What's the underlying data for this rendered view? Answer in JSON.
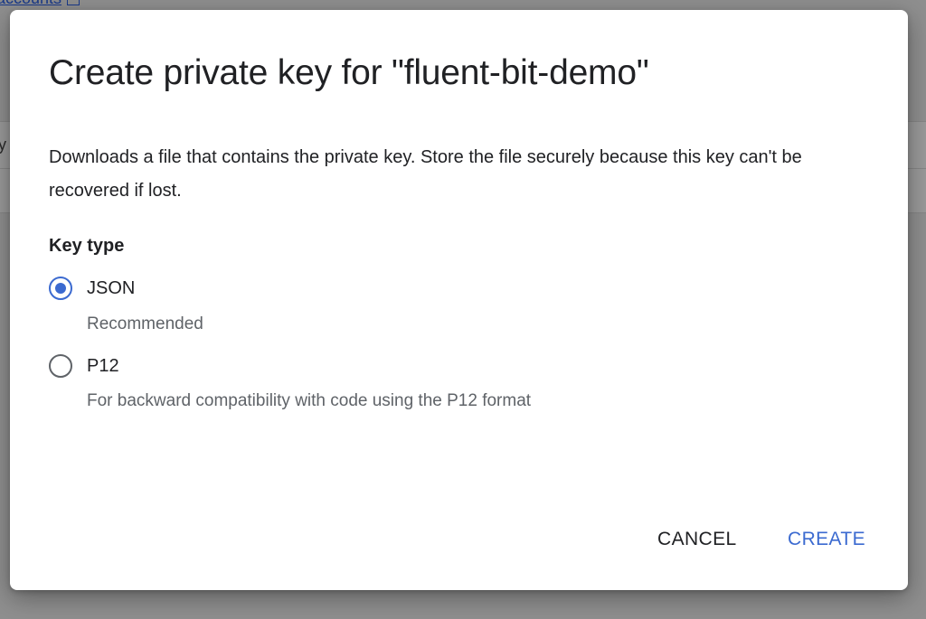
{
  "background": {
    "link_text": "accounts",
    "edge_glyph": "y"
  },
  "dialog": {
    "title": "Create private key for \"fluent-bit-demo\"",
    "description": "Downloads a file that contains the private key. Store the file securely because this key can't be recovered if lost.",
    "key_type_label": "Key type",
    "options": [
      {
        "label": "JSON",
        "hint": "Recommended",
        "selected": true
      },
      {
        "label": "P12",
        "hint": "For backward compatibility with code using the P12 format",
        "selected": false
      }
    ],
    "buttons": {
      "cancel_label": "CANCEL",
      "create_label": "CREATE"
    }
  },
  "colors": {
    "accent": "#3b6ad0",
    "scrim": "#8f8f8f",
    "text_primary": "#202124",
    "text_secondary": "#5f6368"
  },
  "icons": {
    "radio_selected": "radio-checked-icon",
    "radio_unselected": "radio-unchecked-icon",
    "external_link": "external-link-icon"
  }
}
